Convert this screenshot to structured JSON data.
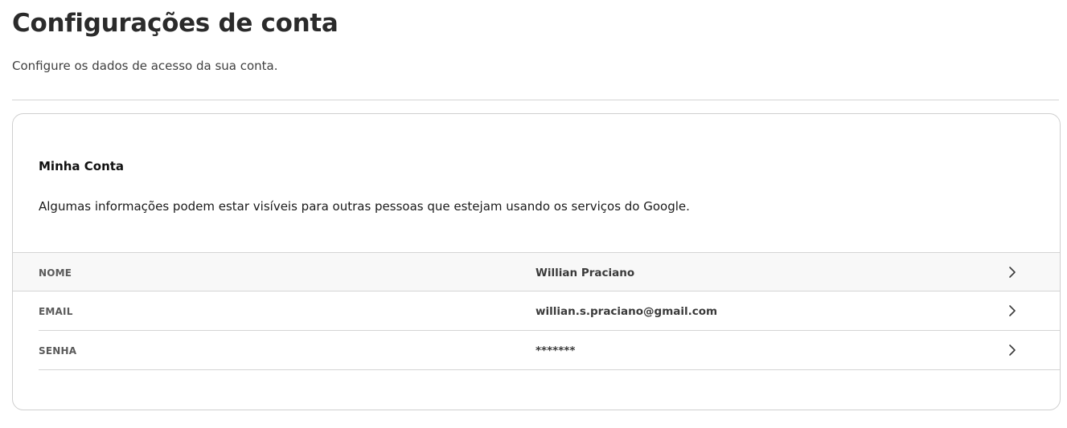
{
  "header": {
    "title": "Configurações de conta",
    "subtitle": "Configure os dados de acesso da sua conta."
  },
  "card": {
    "title": "Minha Conta",
    "description": "Algumas informações podem estar visíveis para outras pessoas que estejam usando os serviços do Google.",
    "rows": [
      {
        "label": "NOME",
        "value": "Willian Praciano",
        "icon": "chevron-right-icon"
      },
      {
        "label": "EMAIL",
        "value": "willian.s.praciano@gmail.com",
        "icon": "chevron-right-icon"
      },
      {
        "label": "SENHA",
        "value": "*******",
        "icon": "chevron-right-icon"
      }
    ]
  },
  "colors": {
    "title": "#2b2b2b",
    "divider": "#d4d4d4",
    "row_highlight": "#f8f8f8"
  }
}
